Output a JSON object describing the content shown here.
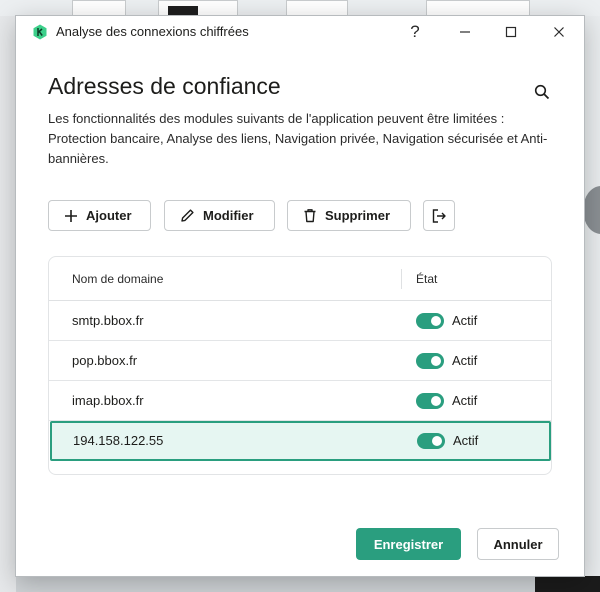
{
  "window": {
    "title": "Analyse des connexions chiffrées",
    "help_glyph": "?"
  },
  "page": {
    "heading": "Adresses de confiance",
    "description": "Les fonctionnalités des modules suivants de l'application peuvent être limitées : Protection bancaire, Analyse des liens, Navigation privée, Navigation sécurisée et Anti-bannières."
  },
  "toolbar": {
    "add_label": "Ajouter",
    "edit_label": "Modifier",
    "delete_label": "Supprimer"
  },
  "table": {
    "columns": [
      "Nom de domaine",
      "État"
    ],
    "rows": [
      {
        "domain": "smtp.bbox.fr",
        "state": "Actif",
        "enabled": true
      },
      {
        "domain": "pop.bbox.fr",
        "state": "Actif",
        "enabled": true
      },
      {
        "domain": "imap.bbox.fr",
        "state": "Actif",
        "enabled": true
      },
      {
        "domain": "194.158.122.55",
        "state": "Actif",
        "enabled": true,
        "selected": true
      }
    ]
  },
  "footer": {
    "save_label": "Enregistrer",
    "cancel_label": "Annuler"
  },
  "colors": {
    "accent": "#2a9e7f",
    "selected_row_bg": "#e6f6f2"
  },
  "icons": [
    "kaspersky-logo-icon",
    "help-icon",
    "minimize-icon",
    "maximize-icon",
    "close-icon",
    "search-icon",
    "plus-icon",
    "pencil-icon",
    "trash-icon",
    "export-icon"
  ]
}
